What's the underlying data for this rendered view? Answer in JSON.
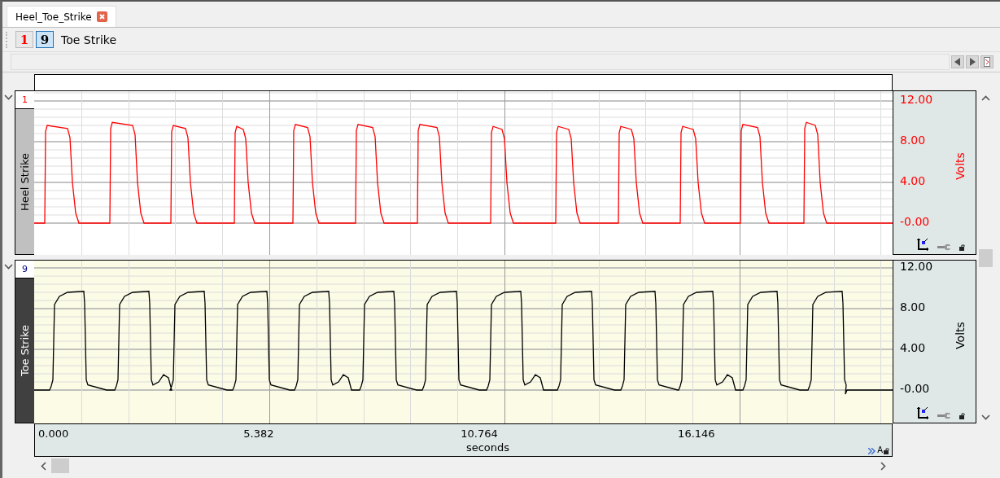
{
  "tabs": [
    {
      "label": "Heel_Toe_Strike",
      "selected": true
    }
  ],
  "channel_buttons": [
    {
      "label": "1",
      "selected": false,
      "color": "#ff0000"
    },
    {
      "label": "9",
      "selected": true,
      "color": "#000000"
    }
  ],
  "channel_title": "Toe Strike",
  "channels": [
    {
      "number": "1",
      "name": "Heel Strike",
      "selected": false,
      "color": "#ff0000",
      "y_ticks": [
        "12.00",
        "8.00",
        "4.00",
        "-0.00"
      ],
      "unit": "Volts"
    },
    {
      "number": "9",
      "name": "Toe Strike",
      "selected": true,
      "color": "#000000",
      "y_ticks": [
        "12.00",
        "8.00",
        "4.00",
        "-0.00"
      ],
      "unit": "Volts"
    }
  ],
  "time_axis": {
    "ticks": [
      "0.000",
      "5.382",
      "10.764",
      "16.146"
    ],
    "label": "seconds",
    "autoscale_label": "A"
  }
}
